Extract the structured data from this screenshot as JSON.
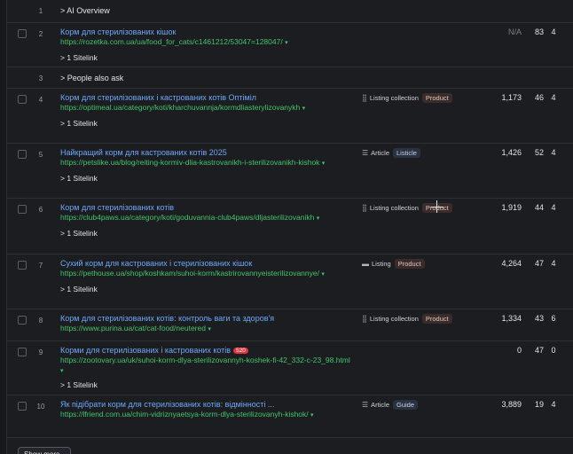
{
  "rows": [
    {
      "num": "1",
      "label": "> AI Overview"
    },
    {
      "num": "2",
      "title": "Корм для стерилізованих кішок",
      "url": "https://rozetka.com.ua/ua/food_for_cats/c1461212/53047=128047/",
      "sitelink": "> 1 Sitelink",
      "traffic": "N/A",
      "dr": "83",
      "x": "4"
    },
    {
      "num": "3",
      "label": "> People also ask"
    },
    {
      "num": "4",
      "title": "Корм для стерилізованих і кастрованих котів Оптімiл",
      "url": "https://optimeal.ua/category/koti/kharchuvannja/kormdliasterylizovanykh",
      "sitelink": "> 1 Sitelink",
      "tag_main": "Listing collection",
      "tag_pill": "Product",
      "traffic": "1,173",
      "dr": "46",
      "x": "4"
    },
    {
      "num": "5",
      "title": "Найкращий корм для кастрованих котів 2025",
      "url": "https://petslike.ua/blog/reiting-kormiv-dlia-kastrovanikh-i-sterilizovanikh-kishok",
      "sitelink": "> 1 Sitelink",
      "tag_main": "Article",
      "tag_pill": "Listicle",
      "traffic": "1,426",
      "dr": "52",
      "x": "4"
    },
    {
      "num": "6",
      "title": "Корм для стерилізованих котів",
      "url": "https://club4paws.ua/category/koti/goduvannia-club4paws/dljasterilizovanikh",
      "sitelink": "> 1 Sitelink",
      "tag_main": "Listing collection",
      "tag_pill": "Product",
      "traffic": "1,919",
      "dr": "44",
      "x": "4"
    },
    {
      "num": "7",
      "title": "Сухий корм для кастрованих і стерилізованих кішок",
      "url": "https://pethouse.ua/shop/koshkam/suhoi-korm/kastrirovannyeisterilizovannye/",
      "sitelink": "> 1 Sitelink",
      "tag_main": "Listing",
      "tag_pill": "Product",
      "traffic": "4,264",
      "dr": "47",
      "x": "4"
    },
    {
      "num": "8",
      "title": "Корм для стерилізованих котів: контроль ваги та здоров'я",
      "url": "https://www.purina.ua/cat/cat-food/neutered",
      "tag_main": "Listing collection",
      "tag_pill": "Product",
      "traffic": "1,334",
      "dr": "43",
      "x": "6"
    },
    {
      "num": "9",
      "title": "Корми для стерилізованих і кастрованих котів",
      "badge": "520",
      "url": "https://zootovary.ua/uk/suhoi-korm-dlya-sterilizovannyh-koshek-fi-42_332-c-23_98.html",
      "sitelink": "> 1 Sitelink",
      "traffic": "0",
      "dr": "47",
      "x": "0"
    },
    {
      "num": "10",
      "title": "Як підібрати корм для стерилізованих котів: відмінності ...",
      "url": "https://lfriend.com.ua/chim-vidriznyaetsya-korm-dlya-sterilizovanyh-kishok/",
      "tag_main": "Article",
      "tag_pill": "Guide",
      "traffic": "3,889",
      "dr": "19",
      "x": "4"
    }
  ],
  "caret": "▾",
  "footer_btn": "Show more"
}
